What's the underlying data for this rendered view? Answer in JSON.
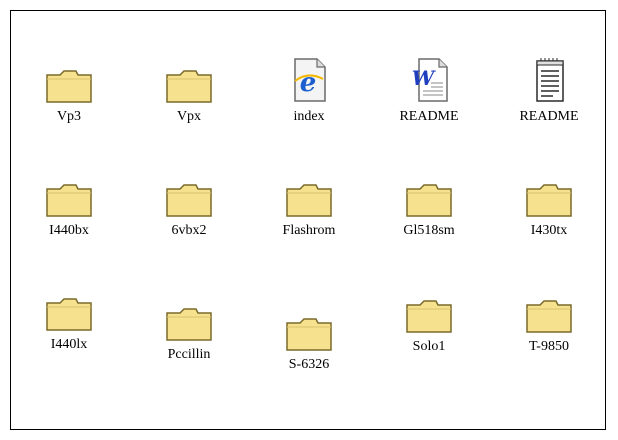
{
  "items": [
    {
      "label": "Vp3",
      "icon": "folder-icon"
    },
    {
      "label": "Vpx",
      "icon": "folder-icon"
    },
    {
      "label": "index",
      "icon": "ie-document-icon"
    },
    {
      "label": "README",
      "icon": "word-document-icon"
    },
    {
      "label": "README",
      "icon": "notepad-document-icon"
    },
    {
      "label": "I440bx",
      "icon": "folder-icon"
    },
    {
      "label": "6vbx2",
      "icon": "folder-icon"
    },
    {
      "label": "Flashrom",
      "icon": "folder-icon"
    },
    {
      "label": "Gl518sm",
      "icon": "folder-icon"
    },
    {
      "label": "I430tx",
      "icon": "folder-icon"
    },
    {
      "label": "I440lx",
      "icon": "folder-icon"
    },
    {
      "label": "Pccillin",
      "icon": "folder-icon"
    },
    {
      "label": "S-6326",
      "icon": "folder-icon"
    },
    {
      "label": "Solo1",
      "icon": "folder-icon"
    },
    {
      "label": "T-9850",
      "icon": "folder-icon"
    }
  ],
  "colors": {
    "folder_fill": "#f6e28e",
    "folder_outline": "#7a6a2a",
    "ie_blue": "#1e5fcf",
    "word_blue": "#1f3fbf"
  }
}
